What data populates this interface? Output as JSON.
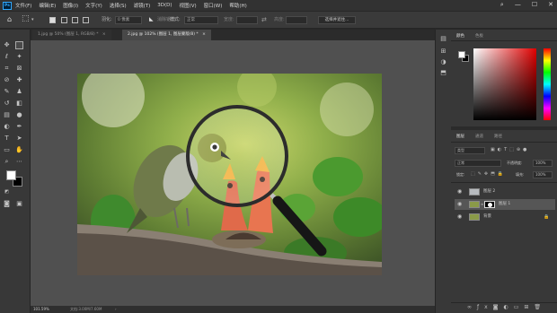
{
  "menubar": {
    "logo": "Ps",
    "items": [
      "文件(F)",
      "编辑(E)",
      "图像(I)",
      "文字(Y)",
      "选择(S)",
      "滤镜(T)",
      "3D(D)",
      "视图(V)",
      "窗口(W)",
      "帮助(H)"
    ],
    "controls": {
      "search": "⌕",
      "minimize": "—",
      "maximize": "☐",
      "close": "✕"
    }
  },
  "options": {
    "feather_label": "羽化:",
    "feather_value": "0 像素",
    "antialias_label": "消除锯齿",
    "style_label": "样式:",
    "style_value": "正常",
    "width_label": "宽度:",
    "height_label": "高度:",
    "select_mask_button": "选择并遮住..."
  },
  "tabs": [
    {
      "label": "1.jpg @ 50% (图层 1, RGB/8) *",
      "close": "×",
      "active": false
    },
    {
      "label": "2.jpg @ 102% (图层 1, 图层蒙版/8) *",
      "close": "×",
      "active": true
    }
  ],
  "status": {
    "zoom": "101.59%",
    "doc_info": "文档:3.00M/7.60M"
  },
  "color_panel": {
    "tab_color": "颜色",
    "tab_swatches": "色板"
  },
  "layers_panel": {
    "tab_layers": "图层",
    "tab_channels": "通道",
    "tab_paths": "路径",
    "filter_label": "类型",
    "blend_mode": "正常",
    "opacity_label": "不透明度:",
    "opacity_value": "100%",
    "lock_label": "锁定:",
    "fill_label": "填充:",
    "fill_value": "100%",
    "layers": [
      {
        "name": "图层 2",
        "selected": false
      },
      {
        "name": "图层 1",
        "selected": true
      },
      {
        "name": "背景",
        "selected": false
      }
    ]
  },
  "accent": "#31a8ff"
}
